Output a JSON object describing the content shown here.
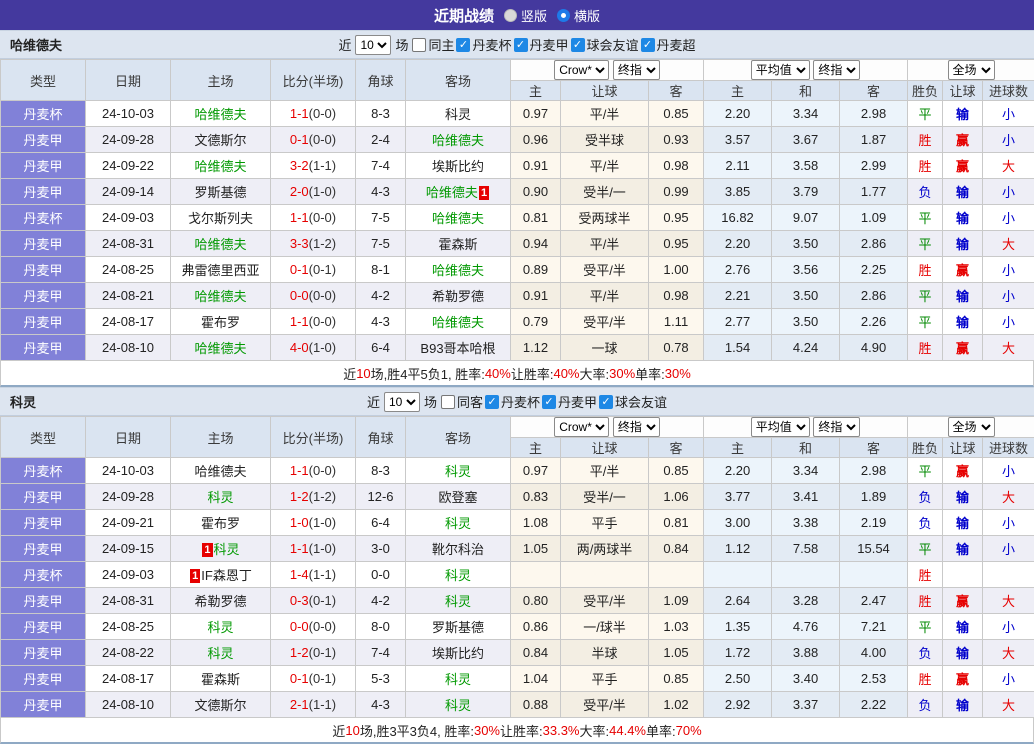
{
  "palette": {
    "titlebar_bg": "#44399e",
    "type_cell_bg": "#8181d8",
    "header_bg": "#dae4f1",
    "focus_team_green": "#009900",
    "score_red": "#e60000",
    "win_red": "#e60000",
    "draw_green": "#008800",
    "lose_blue": "#0000cc",
    "checkbox_blue": "#1e88e5"
  },
  "title_bar": {
    "title": "近期战绩",
    "radio_vertical": "竖版",
    "radio_horizontal": "横版"
  },
  "columns": {
    "main": [
      "类型",
      "日期",
      "主场",
      "比分(半场)",
      "角球",
      "客场"
    ],
    "sub": [
      "主",
      "让球",
      "客",
      "主",
      "和",
      "客",
      "胜负",
      "让球",
      "进球数"
    ]
  },
  "tables": [
    {
      "team": "哈维德夫",
      "filter": {
        "near_label": "近",
        "games": "10",
        "games_label": "场",
        "checkboxes": [
          {
            "label": "同主",
            "checked": false
          },
          {
            "label": "丹麦杯",
            "checked": true
          },
          {
            "label": "丹麦甲",
            "checked": true
          },
          {
            "label": "球会友谊",
            "checked": true
          },
          {
            "label": "丹麦超",
            "checked": true
          }
        ]
      },
      "selects": {
        "company": "Crow*",
        "stage1": "终指",
        "avg": "平均值",
        "stage2": "终指",
        "scope": "全场"
      },
      "rows": [
        {
          "league": "丹麦杯",
          "date": "24-10-03",
          "home": "哈维德夫",
          "home_focus": true,
          "score": "1-1",
          "half": "(0-0)",
          "corner": "8-3",
          "away": "科灵",
          "o1": "0.97",
          "line": "平/半",
          "o2": "0.85",
          "a1": "2.20",
          "a2": "3.34",
          "a3": "2.98",
          "res": "平",
          "res_c": "G",
          "hres": "输",
          "hres_c": "B",
          "gres": "小",
          "gres_c": "B"
        },
        {
          "league": "丹麦甲",
          "date": "24-09-28",
          "home": "文德斯尔",
          "score": "0-1",
          "half": "(0-0)",
          "corner": "2-4",
          "away": "哈维德夫",
          "away_focus": true,
          "o1": "0.96",
          "line": "受半球",
          "o2": "0.93",
          "a1": "3.57",
          "a2": "3.67",
          "a3": "1.87",
          "res": "胜",
          "res_c": "R",
          "hres": "赢",
          "hres_c": "R",
          "gres": "小",
          "gres_c": "B"
        },
        {
          "league": "丹麦甲",
          "date": "24-09-22",
          "home": "哈维德夫",
          "home_focus": true,
          "score": "3-2",
          "half": "(1-1)",
          "corner": "7-4",
          "away": "埃斯比约",
          "o1": "0.91",
          "line": "平/半",
          "o2": "0.98",
          "a1": "2.11",
          "a2": "3.58",
          "a3": "2.99",
          "res": "胜",
          "res_c": "R",
          "hres": "赢",
          "hres_c": "R",
          "gres": "大",
          "gres_c": "R"
        },
        {
          "league": "丹麦甲",
          "date": "24-09-14",
          "home": "罗斯基德",
          "score": "2-0",
          "half": "(1-0)",
          "corner": "4-3",
          "away": "哈维德夫",
          "away_focus": true,
          "away_badge_post": "1",
          "o1": "0.90",
          "line": "受半/一",
          "o2": "0.99",
          "a1": "3.85",
          "a2": "3.79",
          "a3": "1.77",
          "res": "负",
          "res_c": "B",
          "hres": "输",
          "hres_c": "B",
          "gres": "小",
          "gres_c": "B"
        },
        {
          "league": "丹麦杯",
          "date": "24-09-03",
          "home": "戈尔斯列夫",
          "score": "1-1",
          "half": "(0-0)",
          "corner": "7-5",
          "away": "哈维德夫",
          "away_focus": true,
          "o1": "0.81",
          "line": "受两球半",
          "o2": "0.95",
          "a1": "16.82",
          "a2": "9.07",
          "a3": "1.09",
          "res": "平",
          "res_c": "G",
          "hres": "输",
          "hres_c": "B",
          "gres": "小",
          "gres_c": "B"
        },
        {
          "league": "丹麦甲",
          "date": "24-08-31",
          "home": "哈维德夫",
          "home_focus": true,
          "score": "3-3",
          "half": "(1-2)",
          "corner": "7-5",
          "away": "霍森斯",
          "o1": "0.94",
          "line": "平/半",
          "o2": "0.95",
          "a1": "2.20",
          "a2": "3.50",
          "a3": "2.86",
          "res": "平",
          "res_c": "G",
          "hres": "输",
          "hres_c": "B",
          "gres": "大",
          "gres_c": "R"
        },
        {
          "league": "丹麦甲",
          "date": "24-08-25",
          "home": "弗雷德里西亚",
          "score": "0-1",
          "half": "(0-1)",
          "corner": "8-1",
          "away": "哈维德夫",
          "away_focus": true,
          "o1": "0.89",
          "line": "受平/半",
          "o2": "1.00",
          "a1": "2.76",
          "a2": "3.56",
          "a3": "2.25",
          "res": "胜",
          "res_c": "R",
          "hres": "赢",
          "hres_c": "R",
          "gres": "小",
          "gres_c": "B"
        },
        {
          "league": "丹麦甲",
          "date": "24-08-21",
          "home": "哈维德夫",
          "home_focus": true,
          "score": "0-0",
          "half": "(0-0)",
          "corner": "4-2",
          "away": "希勒罗德",
          "o1": "0.91",
          "line": "平/半",
          "o2": "0.98",
          "a1": "2.21",
          "a2": "3.50",
          "a3": "2.86",
          "res": "平",
          "res_c": "G",
          "hres": "输",
          "hres_c": "B",
          "gres": "小",
          "gres_c": "B"
        },
        {
          "league": "丹麦甲",
          "date": "24-08-17",
          "home": "霍布罗",
          "score": "1-1",
          "half": "(0-0)",
          "corner": "4-3",
          "away": "哈维德夫",
          "away_focus": true,
          "o1": "0.79",
          "line": "受平/半",
          "o2": "1.11",
          "a1": "2.77",
          "a2": "3.50",
          "a3": "2.26",
          "res": "平",
          "res_c": "G",
          "hres": "输",
          "hres_c": "B",
          "gres": "小",
          "gres_c": "B"
        },
        {
          "league": "丹麦甲",
          "date": "24-08-10",
          "home": "哈维德夫",
          "home_focus": true,
          "score": "4-0",
          "half": "(1-0)",
          "corner": "6-4",
          "away": "B93哥本哈根",
          "o1": "1.12",
          "line": "一球",
          "o2": "0.78",
          "a1": "1.54",
          "a2": "4.24",
          "a3": "4.90",
          "res": "胜",
          "res_c": "R",
          "hres": "赢",
          "hres_c": "R",
          "gres": "大",
          "gres_c": "R"
        }
      ],
      "summary": [
        {
          "t": "近"
        },
        {
          "t": "10",
          "red": true
        },
        {
          "t": "场,胜4平5负1, 胜率:"
        },
        {
          "t": "40%",
          "red": true
        },
        {
          "t": " 让胜率:"
        },
        {
          "t": "40%",
          "red": true
        },
        {
          "t": " 大率:"
        },
        {
          "t": "30%",
          "red": true
        },
        {
          "t": " 单率:"
        },
        {
          "t": "30%",
          "red": true
        }
      ]
    },
    {
      "team": "科灵",
      "filter": {
        "near_label": "近",
        "games": "10",
        "games_label": "场",
        "checkboxes": [
          {
            "label": "同客",
            "checked": false
          },
          {
            "label": "丹麦杯",
            "checked": true
          },
          {
            "label": "丹麦甲",
            "checked": true
          },
          {
            "label": "球会友谊",
            "checked": true
          }
        ]
      },
      "selects": {
        "company": "Crow*",
        "stage1": "终指",
        "avg": "平均值",
        "stage2": "终指",
        "scope": "全场"
      },
      "rows": [
        {
          "league": "丹麦杯",
          "date": "24-10-03",
          "home": "哈维德夫",
          "score": "1-1",
          "half": "(0-0)",
          "corner": "8-3",
          "away": "科灵",
          "away_focus": true,
          "o1": "0.97",
          "line": "平/半",
          "o2": "0.85",
          "a1": "2.20",
          "a2": "3.34",
          "a3": "2.98",
          "res": "平",
          "res_c": "G",
          "hres": "赢",
          "hres_c": "R",
          "gres": "小",
          "gres_c": "B"
        },
        {
          "league": "丹麦甲",
          "date": "24-09-28",
          "home": "科灵",
          "home_focus": true,
          "score": "1-2",
          "half": "(1-2)",
          "corner": "12-6",
          "away": "欧登塞",
          "o1": "0.83",
          "line": "受半/一",
          "o2": "1.06",
          "a1": "3.77",
          "a2": "3.41",
          "a3": "1.89",
          "res": "负",
          "res_c": "B",
          "hres": "输",
          "hres_c": "B",
          "gres": "大",
          "gres_c": "R"
        },
        {
          "league": "丹麦甲",
          "date": "24-09-21",
          "home": "霍布罗",
          "score": "1-0",
          "half": "(1-0)",
          "corner": "6-4",
          "away": "科灵",
          "away_focus": true,
          "o1": "1.08",
          "line": "平手",
          "o2": "0.81",
          "a1": "3.00",
          "a2": "3.38",
          "a3": "2.19",
          "res": "负",
          "res_c": "B",
          "hres": "输",
          "hres_c": "B",
          "gres": "小",
          "gres_c": "B"
        },
        {
          "league": "丹麦甲",
          "date": "24-09-15",
          "home": "科灵",
          "home_focus": true,
          "home_badge_pre": "1",
          "score": "1-1",
          "half": "(1-0)",
          "corner": "3-0",
          "away": "靴尔科治",
          "o1": "1.05",
          "line": "两/两球半",
          "o2": "0.84",
          "a1": "1.12",
          "a2": "7.58",
          "a3": "15.54",
          "res": "平",
          "res_c": "G",
          "hres": "输",
          "hres_c": "B",
          "gres": "小",
          "gres_c": "B"
        },
        {
          "league": "丹麦杯",
          "date": "24-09-03",
          "home": "IF森恩丁",
          "home_badge_pre": "1",
          "score": "1-4",
          "half": "(1-1)",
          "corner": "0-0",
          "away": "科灵",
          "away_focus": true,
          "o1": "",
          "line": "",
          "o2": "",
          "a1": "",
          "a2": "",
          "a3": "",
          "res": "胜",
          "res_c": "R",
          "hres": "",
          "hres_c": "B",
          "gres": "",
          "gres_c": "B"
        },
        {
          "league": "丹麦甲",
          "date": "24-08-31",
          "home": "希勒罗德",
          "score": "0-3",
          "half": "(0-1)",
          "corner": "4-2",
          "away": "科灵",
          "away_focus": true,
          "o1": "0.80",
          "line": "受平/半",
          "o2": "1.09",
          "a1": "2.64",
          "a2": "3.28",
          "a3": "2.47",
          "res": "胜",
          "res_c": "R",
          "hres": "赢",
          "hres_c": "R",
          "gres": "大",
          "gres_c": "R"
        },
        {
          "league": "丹麦甲",
          "date": "24-08-25",
          "home": "科灵",
          "home_focus": true,
          "score": "0-0",
          "half": "(0-0)",
          "corner": "8-0",
          "away": "罗斯基德",
          "o1": "0.86",
          "line": "一/球半",
          "o2": "1.03",
          "a1": "1.35",
          "a2": "4.76",
          "a3": "7.21",
          "res": "平",
          "res_c": "G",
          "hres": "输",
          "hres_c": "B",
          "gres": "小",
          "gres_c": "B"
        },
        {
          "league": "丹麦甲",
          "date": "24-08-22",
          "home": "科灵",
          "home_focus": true,
          "score": "1-2",
          "half": "(0-1)",
          "corner": "7-4",
          "away": "埃斯比约",
          "o1": "0.84",
          "line": "半球",
          "o2": "1.05",
          "a1": "1.72",
          "a2": "3.88",
          "a3": "4.00",
          "res": "负",
          "res_c": "B",
          "hres": "输",
          "hres_c": "B",
          "gres": "大",
          "gres_c": "R"
        },
        {
          "league": "丹麦甲",
          "date": "24-08-17",
          "home": "霍森斯",
          "score": "0-1",
          "half": "(0-1)",
          "corner": "5-3",
          "away": "科灵",
          "away_focus": true,
          "o1": "1.04",
          "line": "平手",
          "o2": "0.85",
          "a1": "2.50",
          "a2": "3.40",
          "a3": "2.53",
          "res": "胜",
          "res_c": "R",
          "hres": "赢",
          "hres_c": "R",
          "gres": "小",
          "gres_c": "B"
        },
        {
          "league": "丹麦甲",
          "date": "24-08-10",
          "home": "文德斯尔",
          "score": "2-1",
          "half": "(1-1)",
          "corner": "4-3",
          "away": "科灵",
          "away_focus": true,
          "o1": "0.88",
          "line": "受平/半",
          "o2": "1.02",
          "a1": "2.92",
          "a2": "3.37",
          "a3": "2.22",
          "res": "负",
          "res_c": "B",
          "hres": "输",
          "hres_c": "B",
          "gres": "大",
          "gres_c": "R"
        }
      ],
      "summary": [
        {
          "t": "近"
        },
        {
          "t": "10",
          "red": true
        },
        {
          "t": "场,胜3平3负4, 胜率:"
        },
        {
          "t": "30%",
          "red": true
        },
        {
          "t": " 让胜率:"
        },
        {
          "t": "33.3%",
          "red": true
        },
        {
          "t": " 大率:"
        },
        {
          "t": "44.4%",
          "red": true
        },
        {
          "t": " 单率:"
        },
        {
          "t": "70%",
          "red": true
        }
      ]
    }
  ]
}
